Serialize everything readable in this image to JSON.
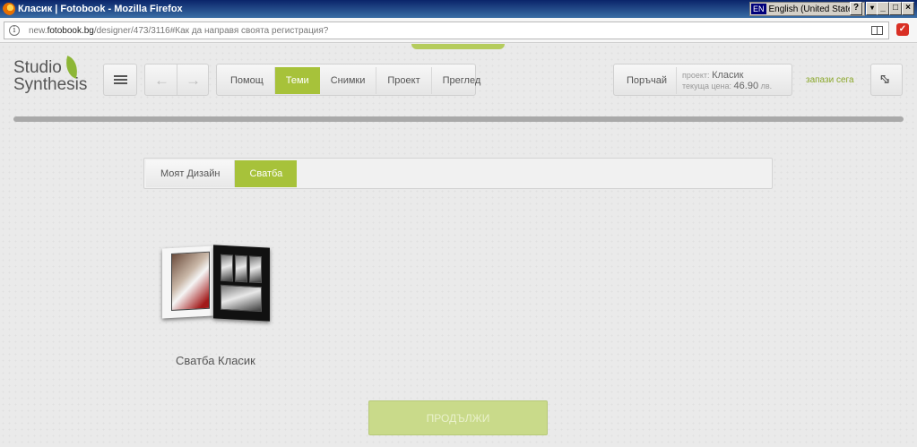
{
  "window": {
    "title": "Класик | Fotobook - Mozilla Firefox",
    "lang_code": "EN",
    "lang_label": "English (United States)"
  },
  "browser": {
    "url_prefix": "new.",
    "url_domain": "fotobook.bg",
    "url_path": "/designer/473/3116#Как да направя своята регистрация?"
  },
  "app": {
    "logo_line1": "Studio",
    "logo_line2": "Synthesis",
    "nav": {
      "help": "Помощ",
      "themes": "Теми",
      "photos": "Снимки",
      "project": "Проект",
      "preview": "Преглед"
    },
    "order": {
      "button": "Поръчай",
      "project_label": "проект:",
      "project_value": "Класик",
      "price_label": "текуща цена:",
      "price_value": "46.90",
      "price_unit": "лв."
    },
    "save_now": "запази сега",
    "theme_tabs": {
      "my_design": "Моят Дизайн",
      "wedding": "Сватба"
    },
    "album_title": "Сватба Класик",
    "continue": "ПРОДЪЛЖИ"
  },
  "colors": {
    "accent": "#a7c23a",
    "continue_disabled": "#c9da8a",
    "titlebar": "#0a246a"
  }
}
